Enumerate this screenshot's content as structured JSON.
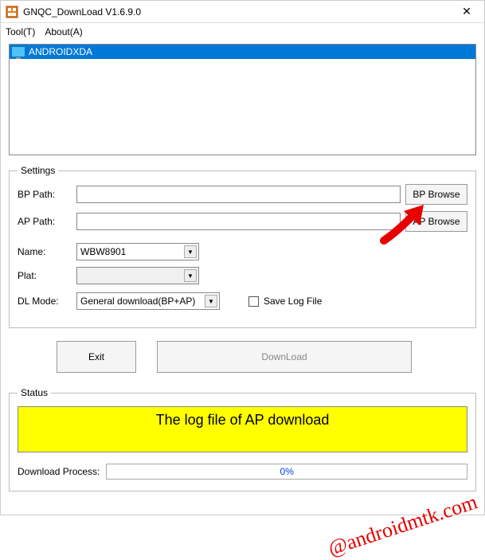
{
  "window": {
    "title": "GNQC_DownLoad V1.6.9.0",
    "close": "✕"
  },
  "menu": {
    "tool": "Tool(T)",
    "about": "About(A)"
  },
  "devices": {
    "item0": "ANDROIDXDA"
  },
  "settings": {
    "legend": "Settings",
    "bp_label": "BP Path:",
    "bp_value": "",
    "bp_browse": "BP Browse",
    "ap_label": "AP Path:",
    "ap_value": "",
    "ap_browse": "AP Browse",
    "name_label": "Name:",
    "name_value": "WBW8901",
    "plat_label": "Plat:",
    "plat_value": "",
    "dlmode_label": "DL Mode:",
    "dlmode_value": "General download(BP+AP)",
    "savelog_label": "Save Log File"
  },
  "buttons": {
    "exit": "Exit",
    "download": "DownLoad"
  },
  "status": {
    "legend": "Status",
    "message": "The log file of AP download",
    "process_label": "Download Process:",
    "process_value": "0%"
  },
  "watermark": "@androidmtk.com"
}
